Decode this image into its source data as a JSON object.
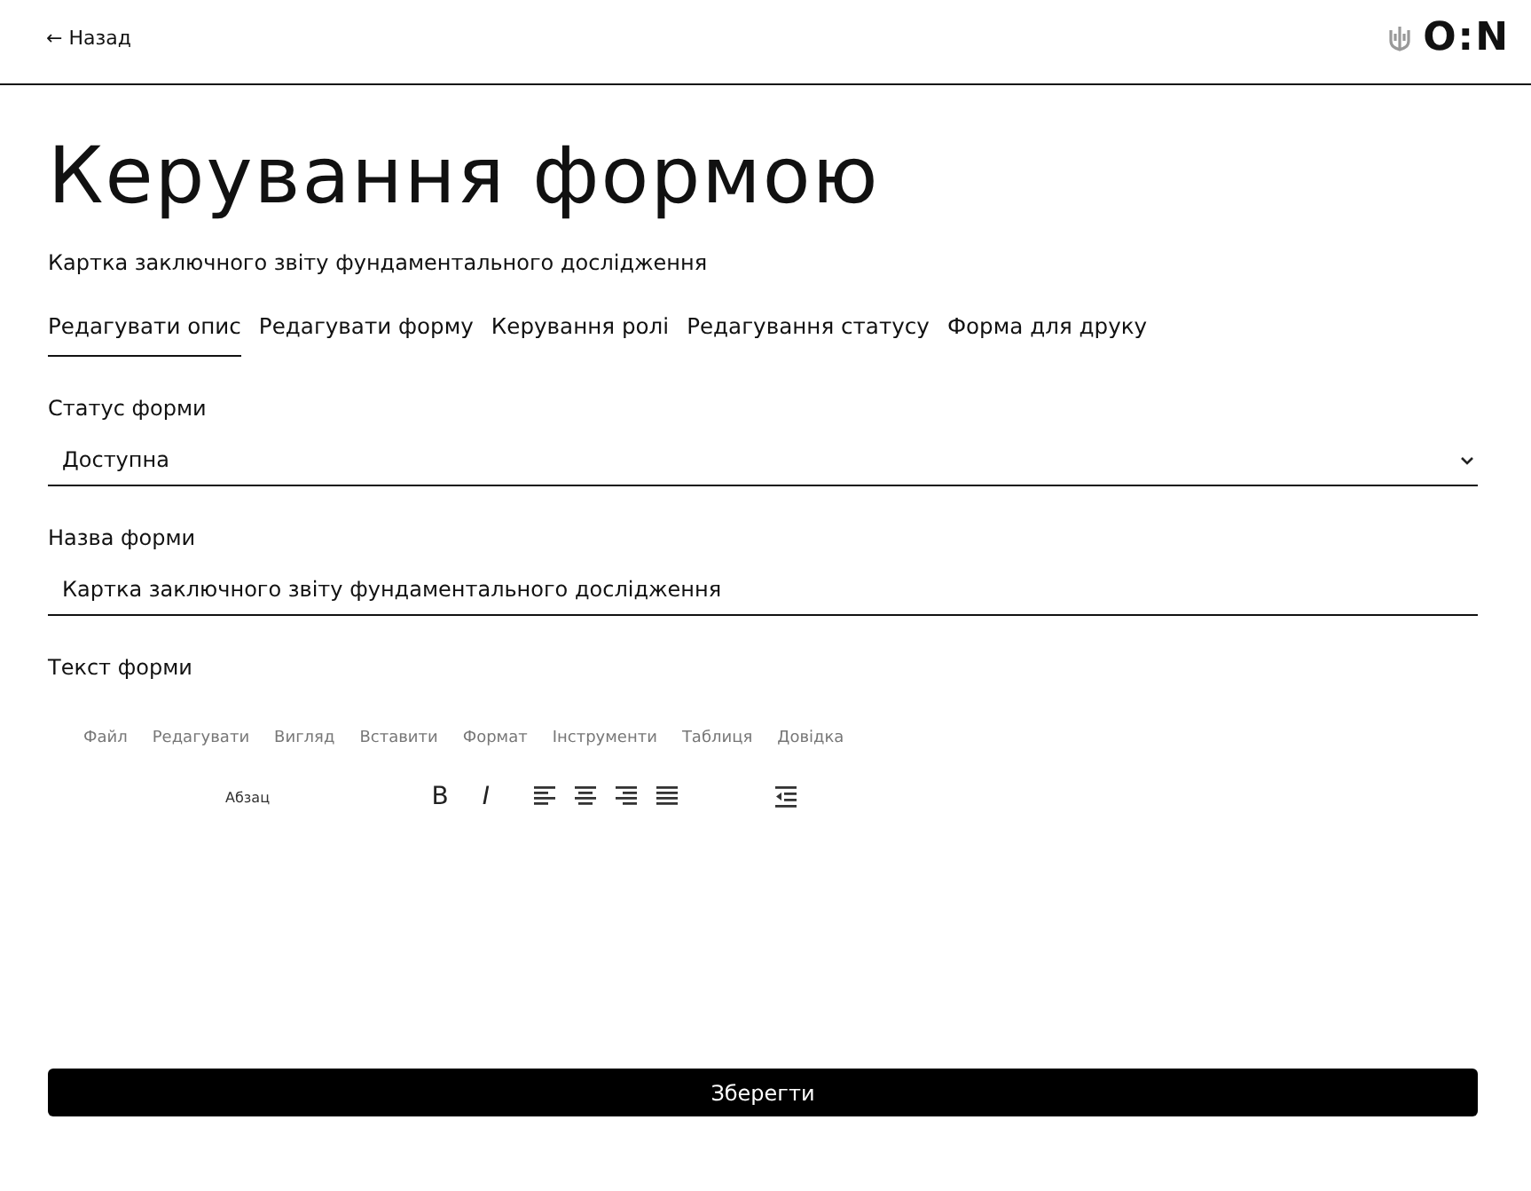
{
  "header": {
    "back_link": "← Назад",
    "logo_text": "O:N"
  },
  "title": "Керування формою",
  "subtitle": "Картка заключного звіту фундаментального дослідження",
  "tabs": [
    {
      "label": "Редагувати опис",
      "selected": true
    },
    {
      "label": "Редагувати форму",
      "selected": false
    },
    {
      "label": "Керування ролі",
      "selected": false
    },
    {
      "label": "Редагування статусу",
      "selected": false
    },
    {
      "label": "Форма для друку",
      "selected": false
    }
  ],
  "status": {
    "label": "Статус форми",
    "value": "Доступна"
  },
  "name": {
    "label": "Назва форми",
    "value": "Картка заключного звіту фундаментального дослідження"
  },
  "editor": {
    "label": "Текст форми",
    "menu": [
      "Файл",
      "Редагувати",
      "Вигляд",
      "Вставити",
      "Формат",
      "Інструменти",
      "Таблиця",
      "Довідка"
    ],
    "block_format": "Абзац",
    "bold": "B",
    "italic": "I"
  },
  "save_button": "Зберегти"
}
